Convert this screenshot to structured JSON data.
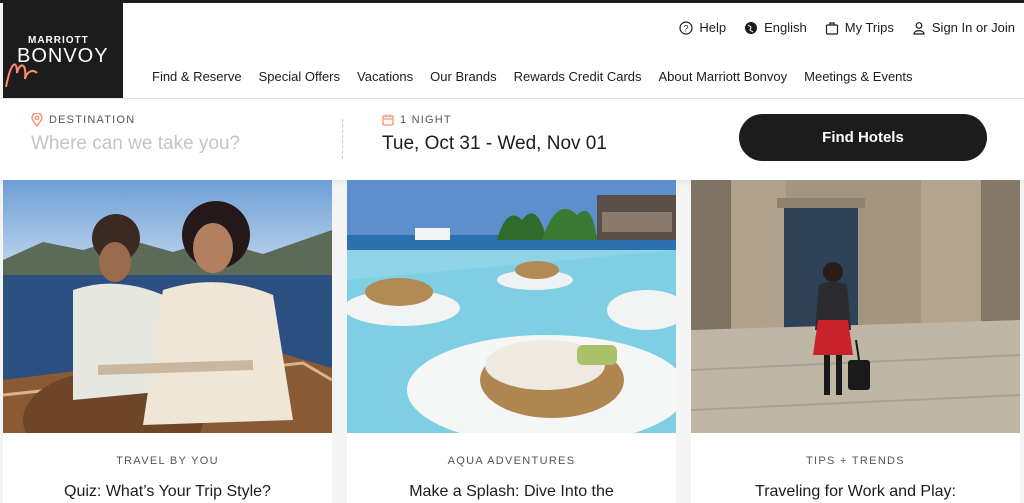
{
  "brand": {
    "line1": "MARRIOTT",
    "line2": "BONVOY"
  },
  "utility": [
    {
      "label": "Help",
      "icon": "help-icon"
    },
    {
      "label": "English",
      "icon": "globe-icon"
    },
    {
      "label": "My Trips",
      "icon": "suitcase-icon"
    },
    {
      "label": "Sign In or Join",
      "icon": "user-icon"
    }
  ],
  "nav": [
    {
      "label": "Find & Reserve"
    },
    {
      "label": "Special Offers"
    },
    {
      "label": "Vacations"
    },
    {
      "label": "Our Brands"
    },
    {
      "label": "Rewards Credit Cards"
    },
    {
      "label": "About Marriott Bonvoy"
    },
    {
      "label": "Meetings & Events"
    }
  ],
  "search": {
    "destination_label": "DESTINATION",
    "destination_placeholder": "Where can we take you?",
    "destination_value": "",
    "nights_label": "1 NIGHT",
    "dates_value": "Tue, Oct 31 - Wed, Nov 01",
    "button_label": "Find Hotels"
  },
  "cards": [
    {
      "eyebrow": "TRAVEL BY YOU",
      "title": "Quiz: What’s Your Trip Style?",
      "image": "couple-on-boat-photo"
    },
    {
      "eyebrow": "AQUA ADVENTURES",
      "title": "Make a Splash: Dive Into the",
      "image": "resort-pool-photo"
    },
    {
      "eyebrow": "TIPS + TRENDS",
      "title": "Traveling for Work and Play:",
      "image": "woman-with-suitcase-photo"
    }
  ],
  "colors": {
    "brand_dark": "#1c1c1c",
    "accent_orange": "#ff8d6b",
    "background": "#f4f4f4"
  }
}
